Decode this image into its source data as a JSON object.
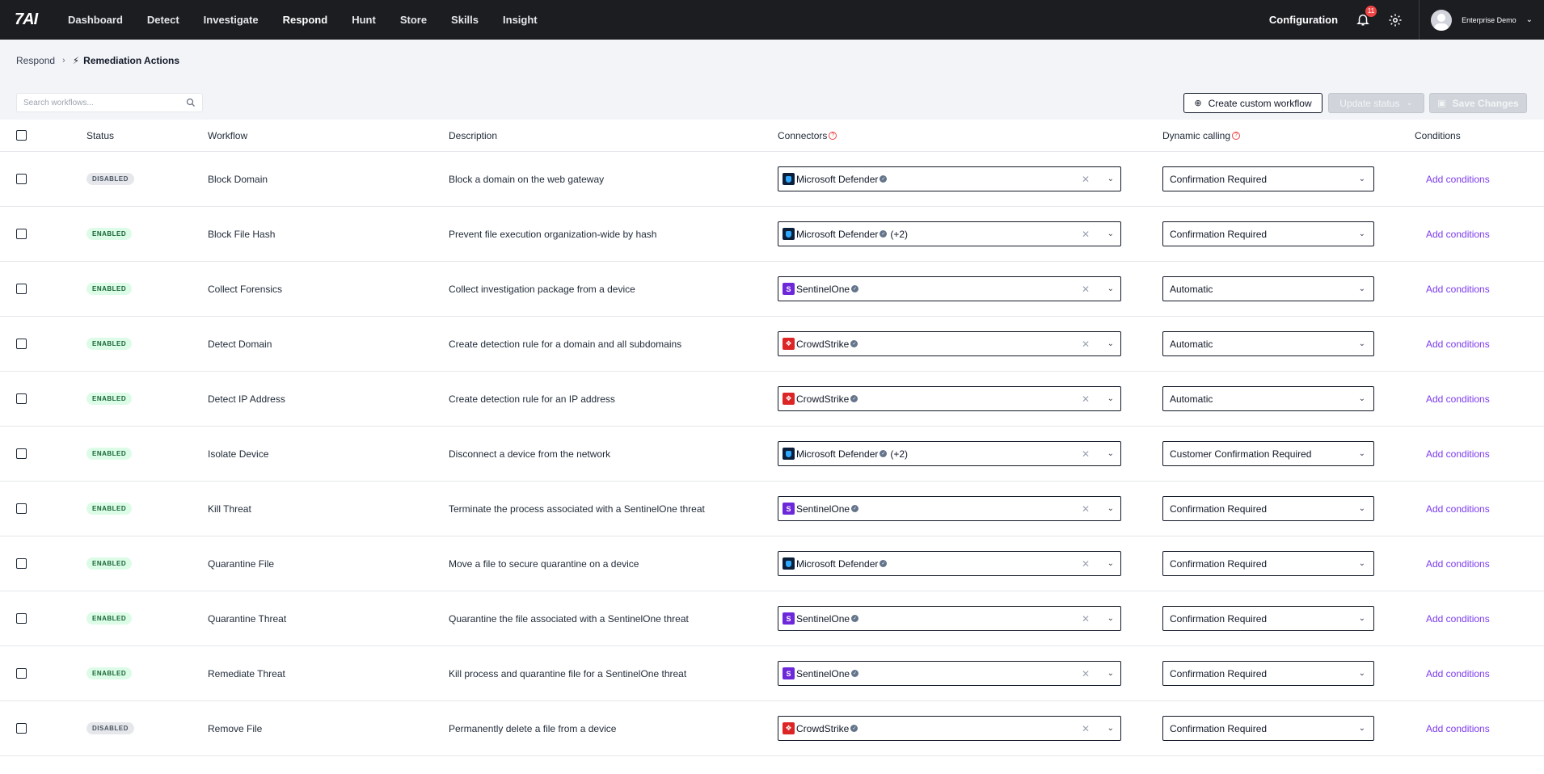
{
  "nav": {
    "logo": "7AI",
    "items": [
      "Dashboard",
      "Detect",
      "Investigate",
      "Respond",
      "Hunt",
      "Store",
      "Skills",
      "Insight"
    ],
    "active_index": 3,
    "configuration": "Configuration",
    "notification_count": "11",
    "user_name": "Enterprise Demo"
  },
  "breadcrumb": {
    "parent": "Respond",
    "current": "Remediation Actions"
  },
  "toolbar": {
    "search_placeholder": "Search workflows...",
    "create_label": "Create custom workflow",
    "update_label": "Update status",
    "save_label": "Save Changes"
  },
  "table": {
    "headers": {
      "status": "Status",
      "workflow": "Workflow",
      "description": "Description",
      "connectors": "Connectors",
      "dynamic": "Dynamic calling",
      "conditions": "Conditions"
    },
    "add_conditions_label": "Add conditions",
    "rows": [
      {
        "status": "DISABLED",
        "workflow": "Block Domain",
        "description": "Block a domain on the web gateway",
        "connector": "Microsoft Defender",
        "connector_logo": "md",
        "extra": "",
        "dynamic": "Confirmation Required"
      },
      {
        "status": "ENABLED",
        "workflow": "Block File Hash",
        "description": "Prevent file execution organization-wide by hash",
        "connector": "Microsoft Defender",
        "connector_logo": "md",
        "extra": "(+2)",
        "dynamic": "Confirmation Required"
      },
      {
        "status": "ENABLED",
        "workflow": "Collect Forensics",
        "description": "Collect investigation package from a device",
        "connector": "SentinelOne",
        "connector_logo": "s1",
        "extra": "",
        "dynamic": "Automatic"
      },
      {
        "status": "ENABLED",
        "workflow": "Detect Domain",
        "description": "Create detection rule for a domain and all subdomains",
        "connector": "CrowdStrike",
        "connector_logo": "cs",
        "extra": "",
        "dynamic": "Automatic"
      },
      {
        "status": "ENABLED",
        "workflow": "Detect IP Address",
        "description": "Create detection rule for an IP address",
        "connector": "CrowdStrike",
        "connector_logo": "cs",
        "extra": "",
        "dynamic": "Automatic"
      },
      {
        "status": "ENABLED",
        "workflow": "Isolate Device",
        "description": "Disconnect a device from the network",
        "connector": "Microsoft Defender",
        "connector_logo": "md",
        "extra": "(+2)",
        "dynamic": "Customer Confirmation Required"
      },
      {
        "status": "ENABLED",
        "workflow": "Kill Threat",
        "description": "Terminate the process associated with a SentinelOne threat",
        "connector": "SentinelOne",
        "connector_logo": "s1",
        "extra": "",
        "dynamic": "Confirmation Required"
      },
      {
        "status": "ENABLED",
        "workflow": "Quarantine File",
        "description": "Move a file to secure quarantine on a device",
        "connector": "Microsoft Defender",
        "connector_logo": "md",
        "extra": "",
        "dynamic": "Confirmation Required"
      },
      {
        "status": "ENABLED",
        "workflow": "Quarantine Threat",
        "description": "Quarantine the file associated with a SentinelOne threat",
        "connector": "SentinelOne",
        "connector_logo": "s1",
        "extra": "",
        "dynamic": "Confirmation Required"
      },
      {
        "status": "ENABLED",
        "workflow": "Remediate Threat",
        "description": "Kill process and quarantine file for a SentinelOne threat",
        "connector": "SentinelOne",
        "connector_logo": "s1",
        "extra": "",
        "dynamic": "Confirmation Required"
      },
      {
        "status": "DISABLED",
        "workflow": "Remove File",
        "description": "Permanently delete a file from a device",
        "connector": "CrowdStrike",
        "connector_logo": "cs",
        "extra": "",
        "dynamic": "Confirmation Required"
      }
    ]
  }
}
